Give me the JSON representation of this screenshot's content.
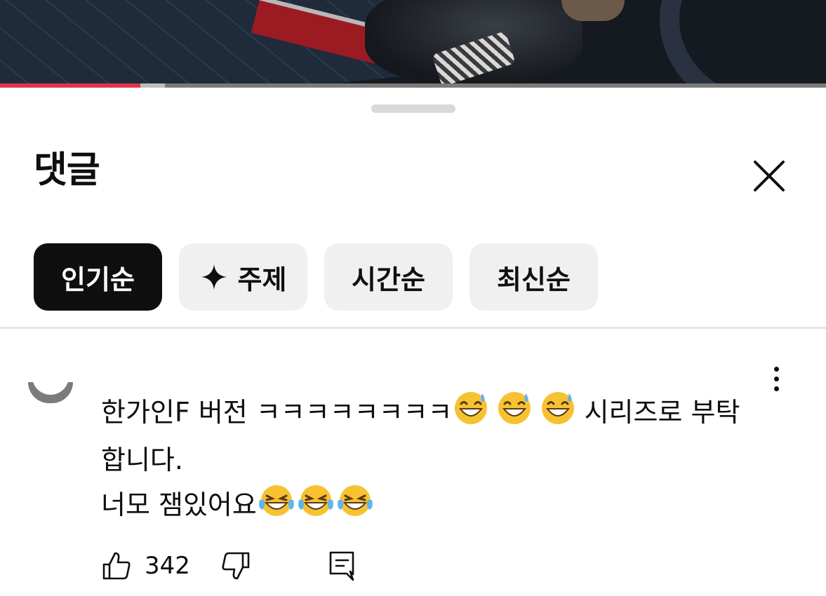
{
  "video": {
    "progress_played": 0.17,
    "progress_buffered": 0.2
  },
  "comments_panel": {
    "title": "댓글",
    "close_icon": "close-icon",
    "sort_chips": [
      {
        "label": "인기순",
        "active": true
      },
      {
        "label": "주제",
        "icon": "sparkle-icon",
        "active": false
      },
      {
        "label": "시간순",
        "active": false
      },
      {
        "label": "최신순",
        "active": false
      }
    ]
  },
  "comment": {
    "avatar_icon": "avatar",
    "line1_a": "한가인F 버전 ㅋㅋㅋㅋㅋㅋㅋㅋ",
    "line1_b": " 시리즈로 부탁",
    "line2": "합니다.",
    "line3": "너모 잼있어요",
    "emoji_sweat": "grinning-face-with-sweat-icon",
    "emoji_laugh": "face-with-tears-of-joy-icon",
    "like_count": "342",
    "more_icon": "more-vert-icon"
  },
  "colors": {
    "accent_red": "#e0334b",
    "chip_active_bg": "#0f0f0f",
    "chip_bg": "#f0f0f0",
    "emoji_yellow": "#f7c232"
  }
}
